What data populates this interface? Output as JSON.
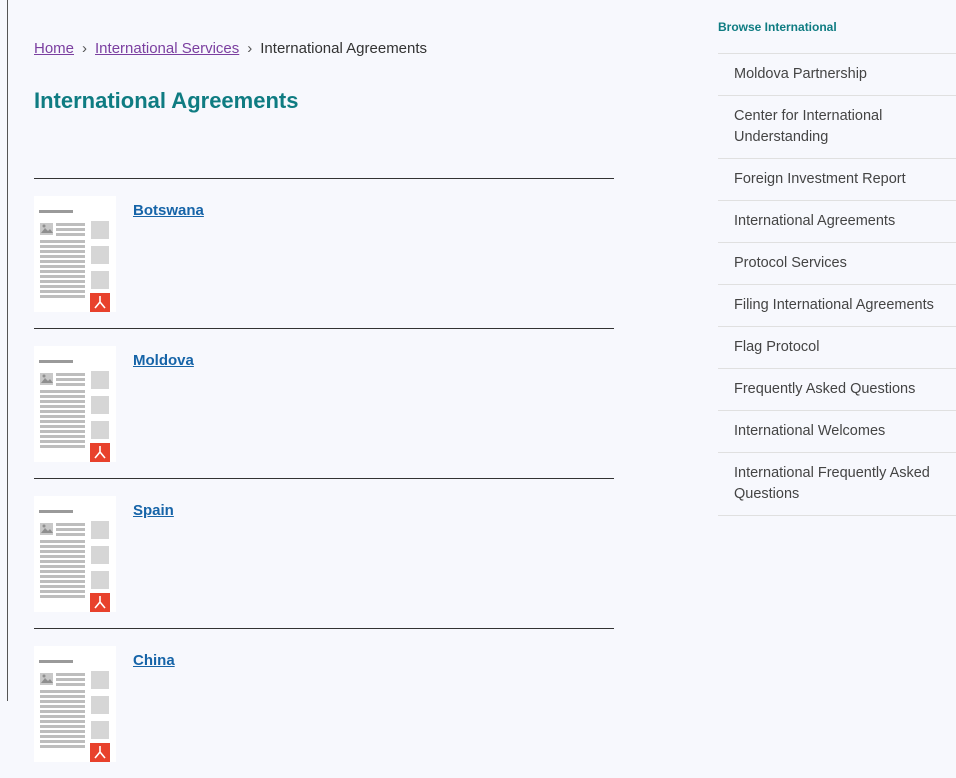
{
  "breadcrumb": {
    "home": "Home",
    "separator": "›",
    "services": "International Services",
    "current": "International Agreements"
  },
  "page_title": "International Agreements",
  "agreements": [
    {
      "name": "Botswana"
    },
    {
      "name": "Moldova"
    },
    {
      "name": "Spain"
    },
    {
      "name": "China"
    }
  ],
  "sidebar": {
    "heading": "Browse International",
    "items": [
      {
        "label": "Moldova Partnership"
      },
      {
        "label": "Center for International Understanding"
      },
      {
        "label": "Foreign Investment Report"
      },
      {
        "label": "International Agreements"
      },
      {
        "label": "Protocol Services"
      },
      {
        "label": "Filing International Agreements"
      },
      {
        "label": "Flag Protocol"
      },
      {
        "label": "Frequently Asked Questions"
      },
      {
        "label": "International Welcomes"
      },
      {
        "label": "International Frequently Asked Questions"
      }
    ]
  },
  "colors": {
    "page_background": "#f7f8fd",
    "title_teal": "#0f7c82",
    "link_blue": "#1664a8",
    "visited_purple": "#7b3fa0",
    "pdf_red": "#e8412c"
  },
  "icons": {
    "document_thumbnail": "pdf-document-icon"
  }
}
